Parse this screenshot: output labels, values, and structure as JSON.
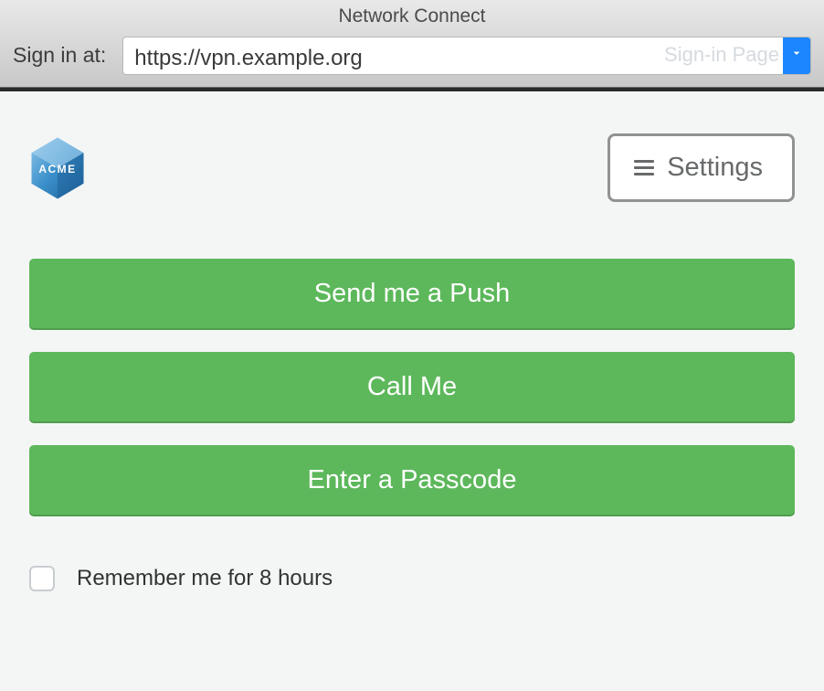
{
  "window": {
    "title": "Network Connect"
  },
  "toolbar": {
    "label": "Sign in at:",
    "url_value": "https://vpn.example.org",
    "signin_page_hint": "Sign-in Page"
  },
  "header": {
    "logo_text": "ACME",
    "settings_label": "Settings"
  },
  "actions": {
    "push_label": "Send me a Push",
    "call_label": "Call Me",
    "passcode_label": "Enter a Passcode"
  },
  "remember": {
    "checked": false,
    "label": "Remember me for 8 hours"
  }
}
